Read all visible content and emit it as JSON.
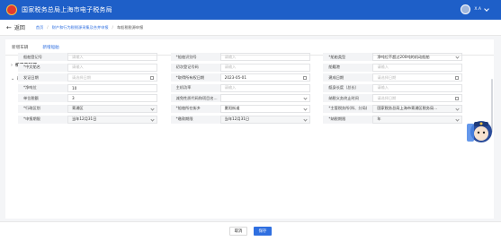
{
  "header": {
    "title": "国家税务总局上海市电子税务局",
    "user": "X.A"
  },
  "breadcrumb": {
    "back": "返回",
    "items": [
      "首页",
      "财产和行为税税源采集及合并申报",
      "车船税税源申报"
    ]
  },
  "tabs": [
    {
      "label": "新增车辆"
    },
    {
      "label": "新增船舶",
      "active": true
    }
  ],
  "sections": {
    "collected": "待采集税源",
    "new": "新增税源"
  },
  "form": {
    "rows": [
      [
        {
          "label": "船舶登记号",
          "value": "请输入",
          "placeholder": true
        },
        {
          "label": "*船舶识别号",
          "value": "请输入",
          "placeholder": true
        },
        {
          "label": "*船舶类型",
          "value": "净吨位不超过200吨的机动船舶",
          "select": true
        }
      ],
      [
        {
          "label": "*中文船名",
          "value": "请输入",
          "placeholder": true
        },
        {
          "label": "初次登记号码",
          "value": "请输入",
          "placeholder": true
        },
        {
          "label": "船籍港",
          "value": "请输入",
          "placeholder": true
        }
      ],
      [
        {
          "label": "发证日期",
          "value": "请选择日期",
          "placeholder": true,
          "date": true
        },
        {
          "label": "*取得所有权日期",
          "value": "2023-05-01",
          "date": true
        },
        {
          "label": "建成日期",
          "value": "请选择日期",
          "placeholder": true,
          "date": true
        }
      ],
      [
        {
          "label": "*净吨位",
          "value": "10"
        },
        {
          "label": "主机功率",
          "value": "请输入",
          "placeholder": true
        },
        {
          "label": "艇身长度（总长）",
          "value": "请输入",
          "placeholder": true
        }
      ],
      [
        {
          "label": "单位税额",
          "value": "3"
        },
        {
          "label": "减免性质代码和项目名...",
          "value": "",
          "select": true
        },
        {
          "label": "纳税义务终止时间",
          "value": "请选择日期",
          "placeholder": true,
          "date": true
        }
      ],
      [
        {
          "label": "*行政区划",
          "value": "青浦区",
          "select": true,
          "gray": true
        },
        {
          "label": "*船舶所在街乡",
          "value": "夏阳街道",
          "select": true
        },
        {
          "label": "*主管税务所(科、分局)",
          "value": "国家税务总局上海市青浦区税务局...",
          "select": true,
          "gray": true
        }
      ],
      [
        {
          "label": "*申报期限",
          "value": "当年12月31日",
          "select": true,
          "gray": true
        },
        {
          "label": "*缴款期限",
          "value": "当年12月31日",
          "select": true,
          "gray": true
        },
        {
          "label": "*纳税期限",
          "value": "年",
          "select": true,
          "gray": true
        }
      ]
    ]
  },
  "footer": {
    "cancel": "取消",
    "save": "保存"
  },
  "colors": {
    "brand": "#1e5fc8",
    "accent": "#2f6fe0"
  }
}
